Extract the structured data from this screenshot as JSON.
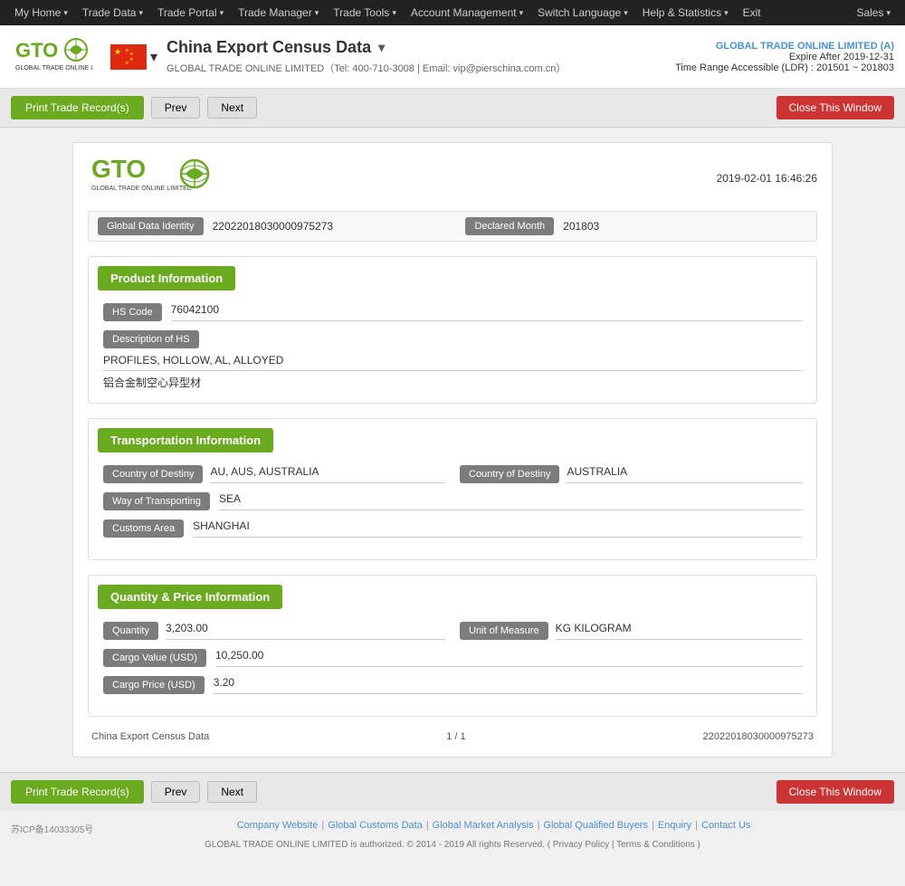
{
  "nav": {
    "items": [
      {
        "label": "My Home",
        "hasArrow": true
      },
      {
        "label": "Trade Data",
        "hasArrow": true
      },
      {
        "label": "Trade Portal",
        "hasArrow": true
      },
      {
        "label": "Trade Manager",
        "hasArrow": true
      },
      {
        "label": "Trade Tools",
        "hasArrow": true
      },
      {
        "label": "Account Management",
        "hasArrow": true
      },
      {
        "label": "Switch Language",
        "hasArrow": true
      },
      {
        "label": "Help & Statistics",
        "hasArrow": true
      },
      {
        "label": "Exit",
        "hasArrow": false
      }
    ],
    "sales_label": "Sales"
  },
  "header": {
    "title": "China Export Census Data",
    "company_contact": "GLOBAL TRADE ONLINE LIMITED（Tel: 400-710-3008 | Email: vip@pierschina.com.cn）",
    "company_name": "GLOBAL TRADE ONLINE LIMITED (A)",
    "expire_label": "Expire After 2019-12-31",
    "ldr_label": "Time Range Accessible (LDR) : 201501 ~ 201803"
  },
  "toolbar": {
    "print_label": "Print Trade Record(s)",
    "prev_label": "Prev",
    "next_label": "Next",
    "close_label": "Close This Window"
  },
  "record": {
    "datetime": "2019-02-01 16:46:26",
    "global_data_identity_label": "Global Data Identity",
    "global_data_identity_value": "22022018030000975273",
    "declared_month_label": "Declared Month",
    "declared_month_value": "201803",
    "sections": {
      "product": {
        "title": "Product Information",
        "hs_code_label": "HS Code",
        "hs_code_value": "76042100",
        "description_label": "Description of HS",
        "description_value_en": "PROFILES, HOLLOW, AL, ALLOYED",
        "description_value_cn": "铝合金制空心异型材"
      },
      "transportation": {
        "title": "Transportation Information",
        "country_of_destiny_label": "Country of Destiny",
        "country_of_destiny_value": "AU, AUS, AUSTRALIA",
        "country_of_destiny_label2": "Country of Destiny",
        "country_of_destiny_value2": "AUSTRALIA",
        "way_of_transporting_label": "Way of Transporting",
        "way_of_transporting_value": "SEA",
        "customs_area_label": "Customs Area",
        "customs_area_value": "SHANGHAI"
      },
      "quantity": {
        "title": "Quantity & Price Information",
        "quantity_label": "Quantity",
        "quantity_value": "3,203.00",
        "unit_of_measure_label": "Unit of Measure",
        "unit_of_measure_value": "KG KILOGRAM",
        "cargo_value_label": "Cargo Value (USD)",
        "cargo_value_value": "10,250.00",
        "cargo_price_label": "Cargo Price (USD)",
        "cargo_price_value": "3.20"
      }
    },
    "footer": {
      "source": "China Export Census Data",
      "page": "1 / 1",
      "record_id": "22022018030000975273"
    }
  },
  "footer": {
    "icp": "苏ICP备14033305号",
    "links": [
      {
        "label": "Company Website"
      },
      {
        "label": "Global Customs Data"
      },
      {
        "label": "Global Market Analysis"
      },
      {
        "label": "Global Qualified Buyers"
      },
      {
        "label": "Enquiry"
      },
      {
        "label": "Contact Us"
      }
    ],
    "copyright": "GLOBAL TRADE ONLINE LIMITED is authorized. © 2014 - 2019 All rights Reserved.  (  Privacy Policy  |  Terms & Conditions  )"
  }
}
